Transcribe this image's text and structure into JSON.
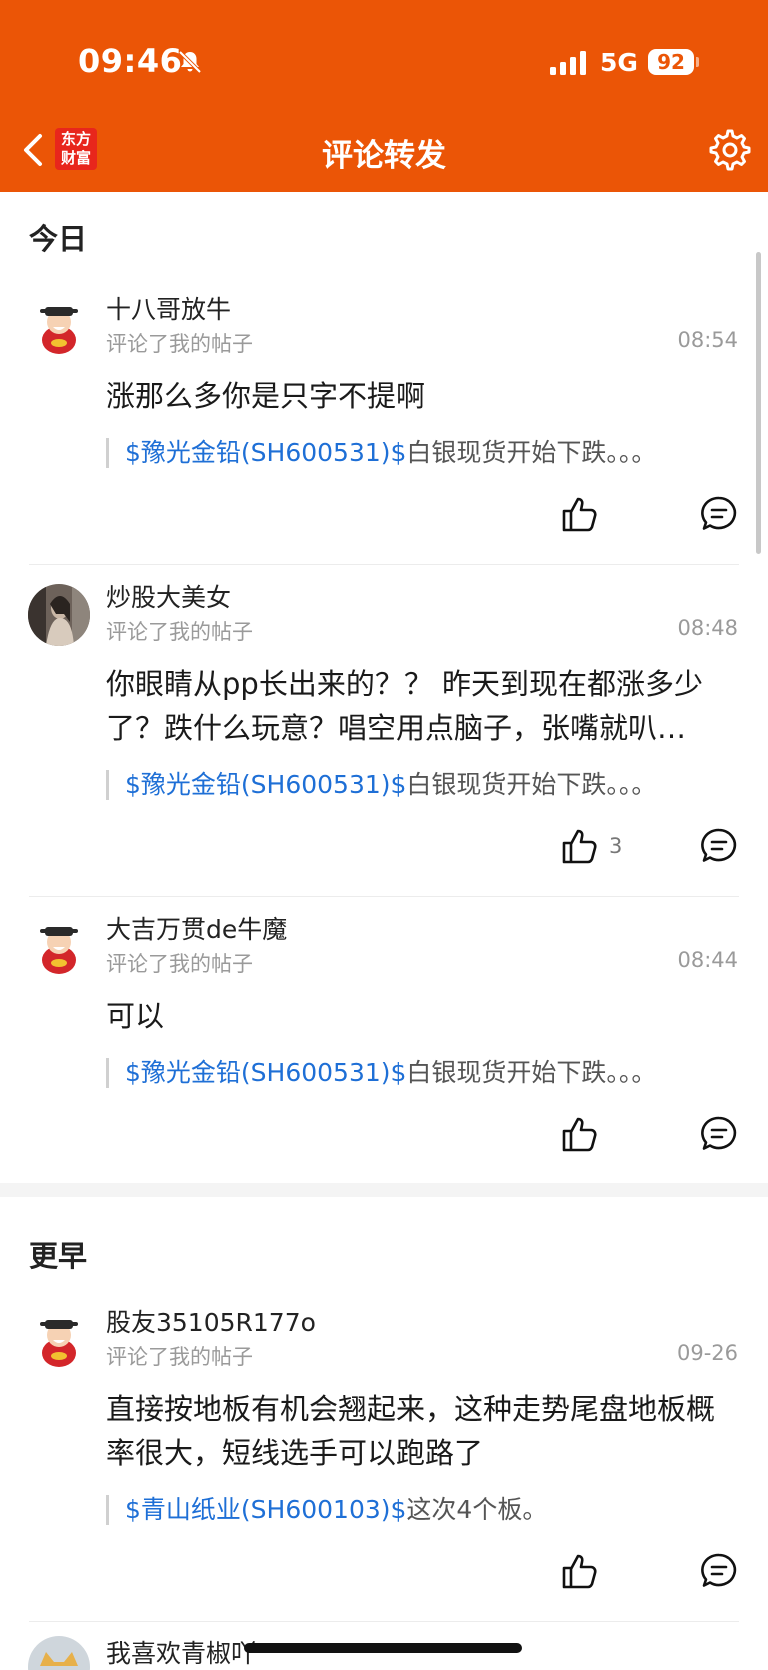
{
  "status_bar": {
    "time": "09:46",
    "network": "5G",
    "battery": "92"
  },
  "nav": {
    "logo_line1": "东方",
    "logo_line2": "财富",
    "title": "评论转发"
  },
  "sections": {
    "today": "今日",
    "earlier": "更早"
  },
  "items": [
    {
      "username": "十八哥放牛",
      "action": "评论了我的帖子",
      "time": "08:54",
      "content": "涨那么多你是只字不提啊",
      "quote_stock": "$豫光金铅(SH600531)$",
      "quote_text": "白银现货开始下跌。。。",
      "likes": ""
    },
    {
      "username": "炒股大美女",
      "action": "评论了我的帖子",
      "time": "08:48",
      "content": "你眼睛从pp长出来的？？ 昨天到现在都涨多少了？跌什么玩意？唱空用点脑子，张嘴就叭…",
      "quote_stock": "$豫光金铅(SH600531)$",
      "quote_text": "白银现货开始下跌。。。",
      "likes": "3"
    },
    {
      "username": "大吉万贯de牛魔",
      "action": "评论了我的帖子",
      "time": "08:44",
      "content": "可以",
      "quote_stock": "$豫光金铅(SH600531)$",
      "quote_text": "白银现货开始下跌。。。",
      "likes": ""
    },
    {
      "username": "股友35105R177o",
      "action": "评论了我的帖子",
      "time": "09-26",
      "content": "直接按地板有机会翘起来，这种走势尾盘地板概率很大，短线选手可以跑路了",
      "quote_stock": "$青山纸业(SH600103)$",
      "quote_text": "这次4个板。",
      "likes": ""
    },
    {
      "username": "我喜欢青椒吖"
    }
  ]
}
